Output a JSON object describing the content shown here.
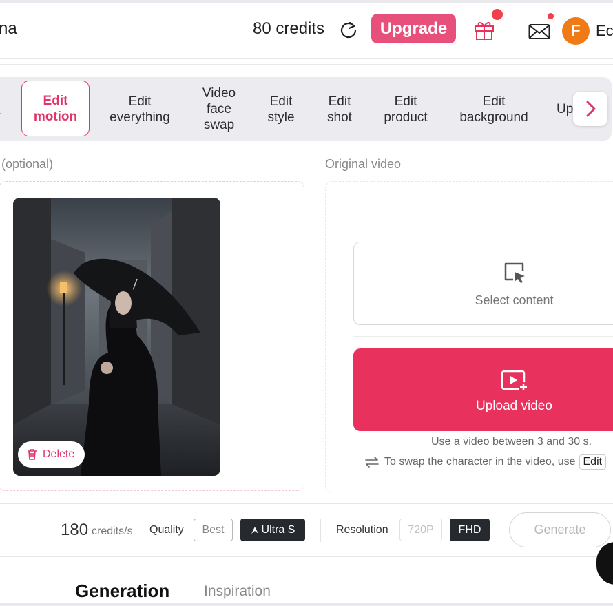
{
  "header": {
    "brand_fragment": "na",
    "credits": "80 credits",
    "upgrade_label": "Upgrade",
    "avatar_initial": "F",
    "username_fragment": "Ec"
  },
  "tabs": {
    "items": [
      {
        "label": "Edit\nmotion",
        "active": true
      },
      {
        "label": "Edit\neverything",
        "active": false
      },
      {
        "label": "Video\nface\nswap",
        "active": false
      },
      {
        "label": "Edit\nstyle",
        "active": false
      },
      {
        "label": "Edit\nshot",
        "active": false
      },
      {
        "label": "Edit\nproduct",
        "active": false
      },
      {
        "label": "Edit\nbackground",
        "active": false
      },
      {
        "label": "Up",
        "active": false
      }
    ]
  },
  "left_panel": {
    "label": "(optional)",
    "delete_label": "Delete"
  },
  "right_panel": {
    "label": "Original video",
    "select_label": "Select content",
    "upload_label": "Upload video",
    "hint_duration": "Use a video between 3 and 30 s.",
    "hint_swap": "To swap the character in the video, use",
    "hint_swap_link": "Edit"
  },
  "bottom_bar": {
    "cost_value": "180",
    "cost_unit": "credits/s",
    "quality_label": "Quality",
    "quality_options": [
      "Best",
      "Ultra S"
    ],
    "quality_selected": "Ultra S",
    "resolution_label": "Resolution",
    "resolution_options": [
      "720P",
      "FHD"
    ],
    "resolution_selected": "FHD",
    "generate_label": "Generate"
  },
  "section_tabs": {
    "generation": "Generation",
    "inspiration": "Inspiration"
  },
  "colors": {
    "accent": "#e8315d",
    "upgrade": "#e8507c",
    "dark_chip": "#262a2e",
    "avatar": "#f07b16",
    "notification": "#f1404b"
  },
  "icons": [
    "refresh-icon",
    "gift-icon",
    "mail-icon",
    "chevron-right-icon",
    "trash-icon",
    "select-cursor-icon",
    "video-add-icon",
    "swap-arrows-icon",
    "ultra-icon"
  ]
}
